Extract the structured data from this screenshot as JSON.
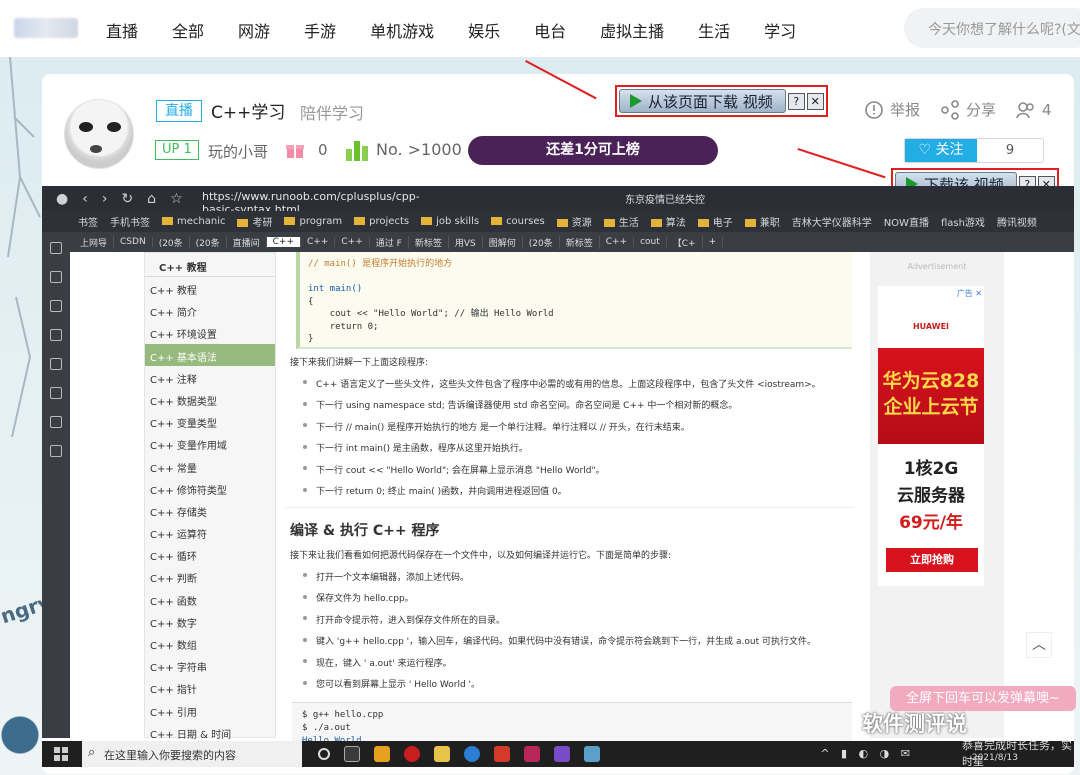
{
  "topnav": {
    "items": [
      "直播",
      "全部",
      "网游",
      "手游",
      "单机游戏",
      "娱乐",
      "电台",
      "虚拟主播",
      "生活",
      "学习"
    ],
    "search_placeholder": "今天你想了解什么呢?(文"
  },
  "room": {
    "live_tag": "直播",
    "title": "C++学习",
    "subtitle": "陪伴学习",
    "up_badge": "UP 1",
    "streamer": "玩的小哥",
    "gift_count": "0",
    "rank": "No. >1000",
    "rank_button": "还差1分可上榜",
    "report": "举报",
    "share": "分享",
    "viewers": "4",
    "follow": "关注",
    "follow_count": "9"
  },
  "download": {
    "page_button": "从该页面下载 视频",
    "video_button": "下载该 视频",
    "help": "?",
    "close": "✕"
  },
  "browser": {
    "url": "https://www.runoob.com/cplusplus/cpp-basic-syntax.html",
    "title_right": "东京疫情已经失控",
    "bookmarks": [
      "书签",
      "手机书签",
      "mechanic",
      "考研",
      "program",
      "projects",
      "job skills",
      "courses",
      "资源",
      "生活",
      "算法",
      "电子",
      "兼职",
      "吉林大学仪器科学",
      "NOW直播",
      "flash游戏",
      "腾讯视频"
    ],
    "tabs": [
      "上网导",
      "CSDN",
      "(20条",
      "(20条",
      "直播间",
      "C++",
      "C++",
      "C++",
      "通过 F",
      "新标签",
      "用VS",
      "图解何",
      "(20条",
      "新标签",
      "C++",
      "cout",
      "【C+",
      "+"
    ],
    "active_tab_index": 5
  },
  "runoob": {
    "nav_header": "C++ 教程",
    "nav_items": [
      "C++ 教程",
      "C++ 简介",
      "C++ 环境设置",
      "C++ 基本语法",
      "C++ 注释",
      "C++ 数据类型",
      "C++ 变量类型",
      "C++ 变量作用域",
      "C++ 常量",
      "C++ 修饰符类型",
      "C++ 存储类",
      "C++ 运算符",
      "C++ 循环",
      "C++ 判断",
      "C++ 函数",
      "C++ 数字",
      "C++ 数组",
      "C++ 字符串",
      "C++ 指针",
      "C++ 引用",
      "C++ 日期 & 时间"
    ],
    "active_nav_index": 3,
    "code_comment": "// main() 是程序开始执行的地方",
    "code_int_main": "int main()",
    "code_open": "{",
    "code_cout": "cout << \"Hello World\"; // 输出 Hello World",
    "code_return": "return 0;",
    "code_close": "}",
    "explain_intro": "接下来我们讲解一下上面这段程序:",
    "explain_items": [
      "C++ 语言定义了一些头文件，这些头文件包含了程序中必需的或有用的信息。上面这段程序中，包含了头文件 <iostream>。",
      "下一行 using namespace std; 告诉编译器使用 std 命名空间。命名空间是 C++ 中一个相对新的概念。",
      "下一行 // main() 是程序开始执行的地方 是一个单行注释。单行注释以 // 开头，在行末结束。",
      "下一行 int main() 是主函数，程序从这里开始执行。",
      "下一行 cout << \"Hello World\"; 会在屏幕上显示消息 \"Hello World\"。",
      "下一行 return 0; 终止 main( )函数，并向调用进程返回值 0。"
    ],
    "section_title": "编译 & 执行 C++ 程序",
    "section_intro": "接下来让我们看看如何把源代码保存在一个文件中，以及如何编译并运行它。下面是简单的步骤:",
    "steps": [
      "打开一个文本编辑器，添加上述代码。",
      "保存文件为 hello.cpp。",
      "打开命令提示符，进入到保存文件所在的目录。",
      "键入 'g++ hello.cpp '，输入回车，编译代码。如果代码中没有错误，命令提示符会跳到下一行，并生成 a.out 可执行文件。",
      "现在，键入 ' a.out' 来运行程序。",
      "您可以看到屏幕上显示 ' Hello World '。"
    ],
    "shell_1": "$ g++ hello.cpp",
    "shell_2": "$ ./a.out",
    "shell_3": "Hello World"
  },
  "ad": {
    "label": "Advertisement",
    "close": "广告 ✕",
    "brand": "HUAWEI",
    "headline_1": "华为云828",
    "headline_2": "企业上云节",
    "spec_1": "1核2G",
    "spec_2": "云服务器",
    "price": "69元/年",
    "buy": "立即抢购"
  },
  "overlay": {
    "promo": "全屏下回车可以发弹幕噢~",
    "watermark": "软件测评说",
    "notify": "恭喜完成时长任务，实时星",
    "angry": "ngry"
  },
  "taskbar": {
    "search": "在这里输入你要搜索的内容",
    "date": "2021/8/13"
  }
}
